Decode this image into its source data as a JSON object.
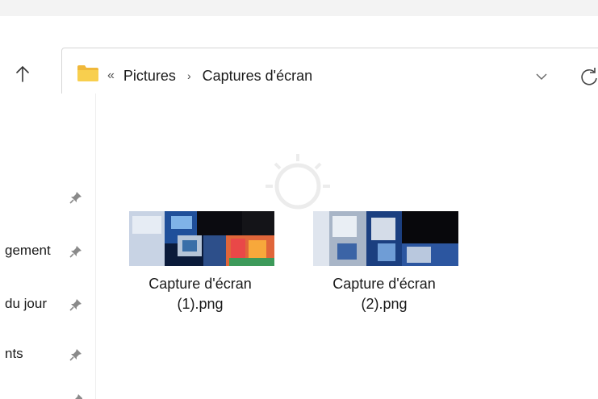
{
  "address": {
    "overflow_glyph": "«",
    "crumbs": [
      "Pictures",
      "Captures d'écran"
    ],
    "separator": "›"
  },
  "nav": {
    "items": [
      {
        "label": ""
      },
      {
        "label": "gement"
      },
      {
        "label": "du jour"
      },
      {
        "label": "nts"
      }
    ]
  },
  "files": [
    {
      "name_line1": "Capture d'écran",
      "name_line2": "(1).png"
    },
    {
      "name_line1": "Capture d'écran",
      "name_line2": "(2).png"
    }
  ],
  "colors": {
    "folder": "#f5c33b",
    "accent": "#0067c0"
  }
}
